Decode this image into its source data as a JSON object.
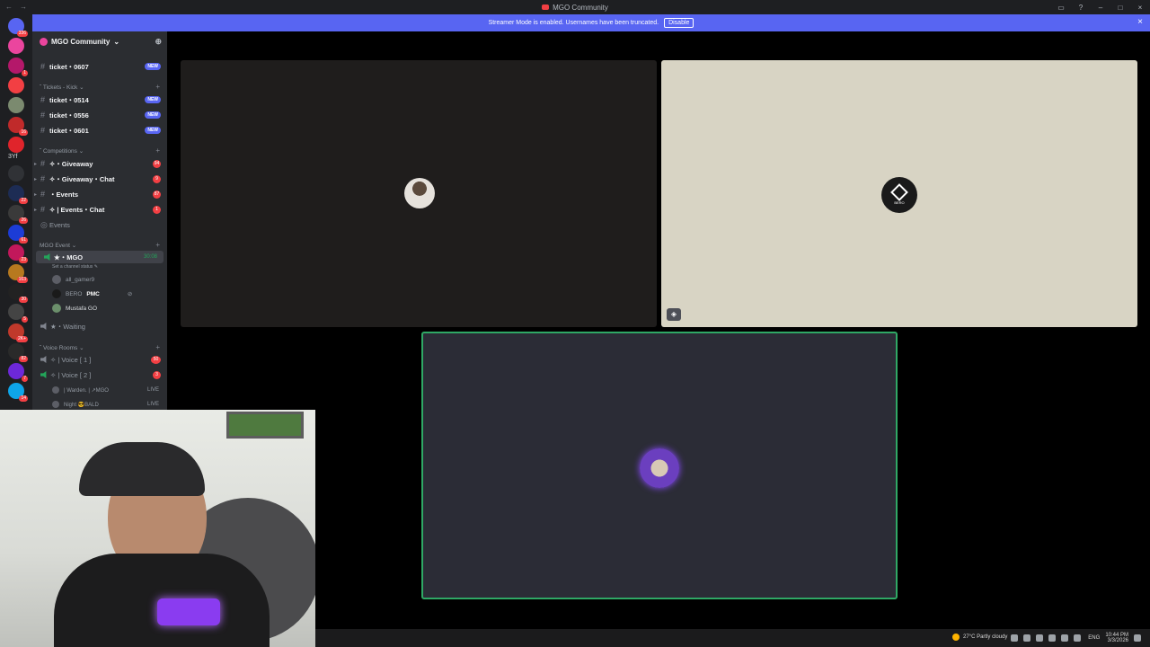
{
  "window": {
    "title": "MGO Community",
    "controls": [
      "–",
      "□",
      "×"
    ]
  },
  "banner": {
    "text": "Streamer Mode is enabled. Usernames have been truncated.",
    "button": "Disable"
  },
  "servers": [
    {
      "badge": "336",
      "color": "#5865f2"
    },
    {
      "badge": "",
      "color": "#eb459e"
    },
    {
      "badge": "1",
      "color": "#b4186a"
    },
    {
      "badge": "",
      "color": "#f23f43"
    },
    {
      "badge": "",
      "color": "#7b8a6f"
    },
    {
      "badge": "16",
      "color": "#c02a2a"
    },
    {
      "badge": "",
      "color": "#e0242b"
    },
    {
      "badge": "",
      "color": "#303236"
    },
    {
      "badge": "22",
      "color": "#1d2c54"
    },
    {
      "badge": "26",
      "color": "#3a3a3a"
    },
    {
      "badge": "61",
      "color": "#1c3cd6"
    },
    {
      "badge": "23",
      "color": "#c2185b"
    },
    {
      "badge": "163",
      "color": "#b7791f"
    },
    {
      "badge": "30",
      "color": "#222"
    },
    {
      "badge": "5",
      "color": "#444"
    },
    {
      "badge": "2K+",
      "color": "#c0392b"
    },
    {
      "badge": "82",
      "color": "#2a2a2a"
    },
    {
      "badge": "7",
      "color": "#6d28d9"
    },
    {
      "badge": "14",
      "color": "#0ea5e9"
    }
  ],
  "server_text_icon": "3Yf",
  "guild": {
    "name": "MGO Community",
    "chevron": "⌄"
  },
  "channels": {
    "ticket_top": {
      "name": "ticket・0607",
      "badge": "NEW"
    },
    "cat_kick": "Tickets - Kick",
    "tickets": [
      {
        "name": "ticket・0514",
        "badge": "NEW"
      },
      {
        "name": "ticket・0556",
        "badge": "NEW"
      },
      {
        "name": "ticket・0601",
        "badge": "NEW"
      }
    ],
    "cat_comp": "Competitions",
    "comp": [
      {
        "name": "✧・Giveaway",
        "badge": "94"
      },
      {
        "name": "✧・Giveaway・Chat",
        "badge": "9"
      },
      {
        "name": "・Events",
        "badge": "87"
      },
      {
        "name": "✧ | Events・Chat",
        "badge": "1"
      }
    ],
    "events_label": "Events",
    "cat_event": "MGO Event",
    "voice_mgo": {
      "name": "★・MGO",
      "timer": "30:08",
      "status": "Set a channel status ✎"
    },
    "members": [
      {
        "name": "all_gamer9"
      },
      {
        "name": "BERO",
        "tag": "PMC"
      },
      {
        "name": "Mustafa GO"
      }
    ],
    "waiting": "★・Waiting",
    "cat_voice": "Voice Rooms",
    "voice_rooms": [
      {
        "name": "✧ | Voice [ 1 ]",
        "badge": "50"
      },
      {
        "name": "✧ | Voice [ 2 ]",
        "badge": "3"
      }
    ],
    "live_members": [
      {
        "name": "| Warden. | ↗MGO",
        "badge": "LIVE"
      },
      {
        "name": "Night 😎BALD",
        "badge": "LIVE"
      }
    ]
  },
  "tiles": {
    "second_label": "BERO"
  },
  "taskbar": {
    "weather": "27°C  Partly cloudy",
    "lang": "ENG",
    "time": "10:44 PM",
    "date": "3/3/2026"
  }
}
